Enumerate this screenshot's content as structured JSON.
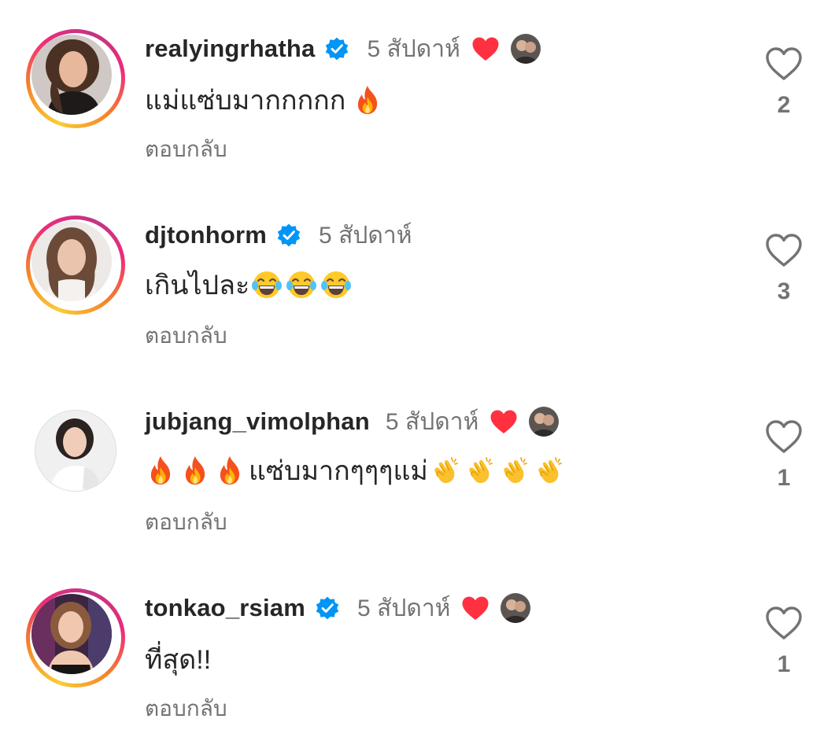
{
  "comments": [
    {
      "username": "realyingrhatha",
      "verified": true,
      "time": "5 สัปดาห์",
      "liked_by_author": true,
      "text": "แม่แซ่บมากกกกก",
      "emojis": [
        "fire-emoji"
      ],
      "reply_label": "ตอบกลับ",
      "like_count": "2"
    },
    {
      "username": "djtonhorm",
      "verified": true,
      "time": "5 สัปดาห์",
      "liked_by_author": false,
      "text": "เกินไปละ",
      "emojis": [
        "joy-emoji",
        "joy-emoji",
        "joy-emoji"
      ],
      "reply_label": "ตอบกลับ",
      "like_count": "3"
    },
    {
      "username": "jubjang_vimolphan",
      "verified": false,
      "time": "5 สัปดาห์",
      "liked_by_author": true,
      "text": "แซ่บมากๆๆๆแม่",
      "leading_emojis": [
        "fire-emoji",
        "fire-emoji",
        "fire-emoji"
      ],
      "emojis": [
        "clap-emoji",
        "clap-emoji",
        "clap-emoji",
        "clap-emoji"
      ],
      "reply_label": "ตอบกลับ",
      "like_count": "1"
    },
    {
      "username": "tonkao_rsiam",
      "verified": true,
      "time": "5 สัปดาห์",
      "liked_by_author": true,
      "text": "ที่สุด!!",
      "emojis": [],
      "reply_label": "ตอบกลับ",
      "like_count": "1"
    }
  ],
  "colors": {
    "verified_blue": "#0095f6",
    "liked_red": "#ff3040",
    "secondary_text": "#737373",
    "primary_text": "#262626"
  }
}
